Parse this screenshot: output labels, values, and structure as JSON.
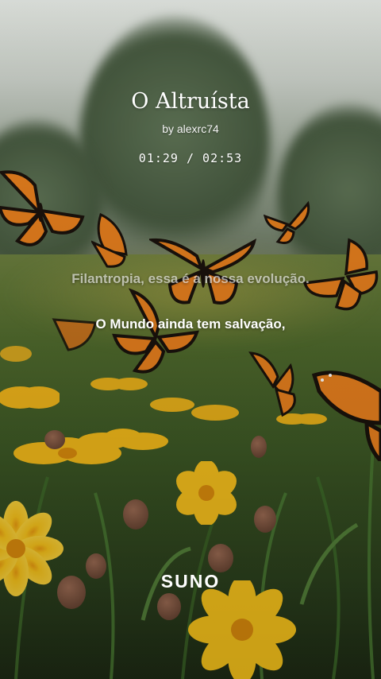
{
  "song": {
    "title": "O Altruísta",
    "artist": "by alexrc74",
    "time_display": "01:29 / 02:53",
    "elapsed": "01:29",
    "duration": "02:53"
  },
  "lyrics": {
    "previous_line": "Filantropia, essa é a nossa evolução.",
    "current_line": "O Mundo ainda tem salvação,"
  },
  "branding": {
    "logo_text": "SUNO"
  },
  "colors": {
    "monarch_orange": "#e8801e",
    "monarch_black": "#1a120c",
    "flower_yellow": "#f6c21b",
    "text_white": "#ffffff"
  }
}
